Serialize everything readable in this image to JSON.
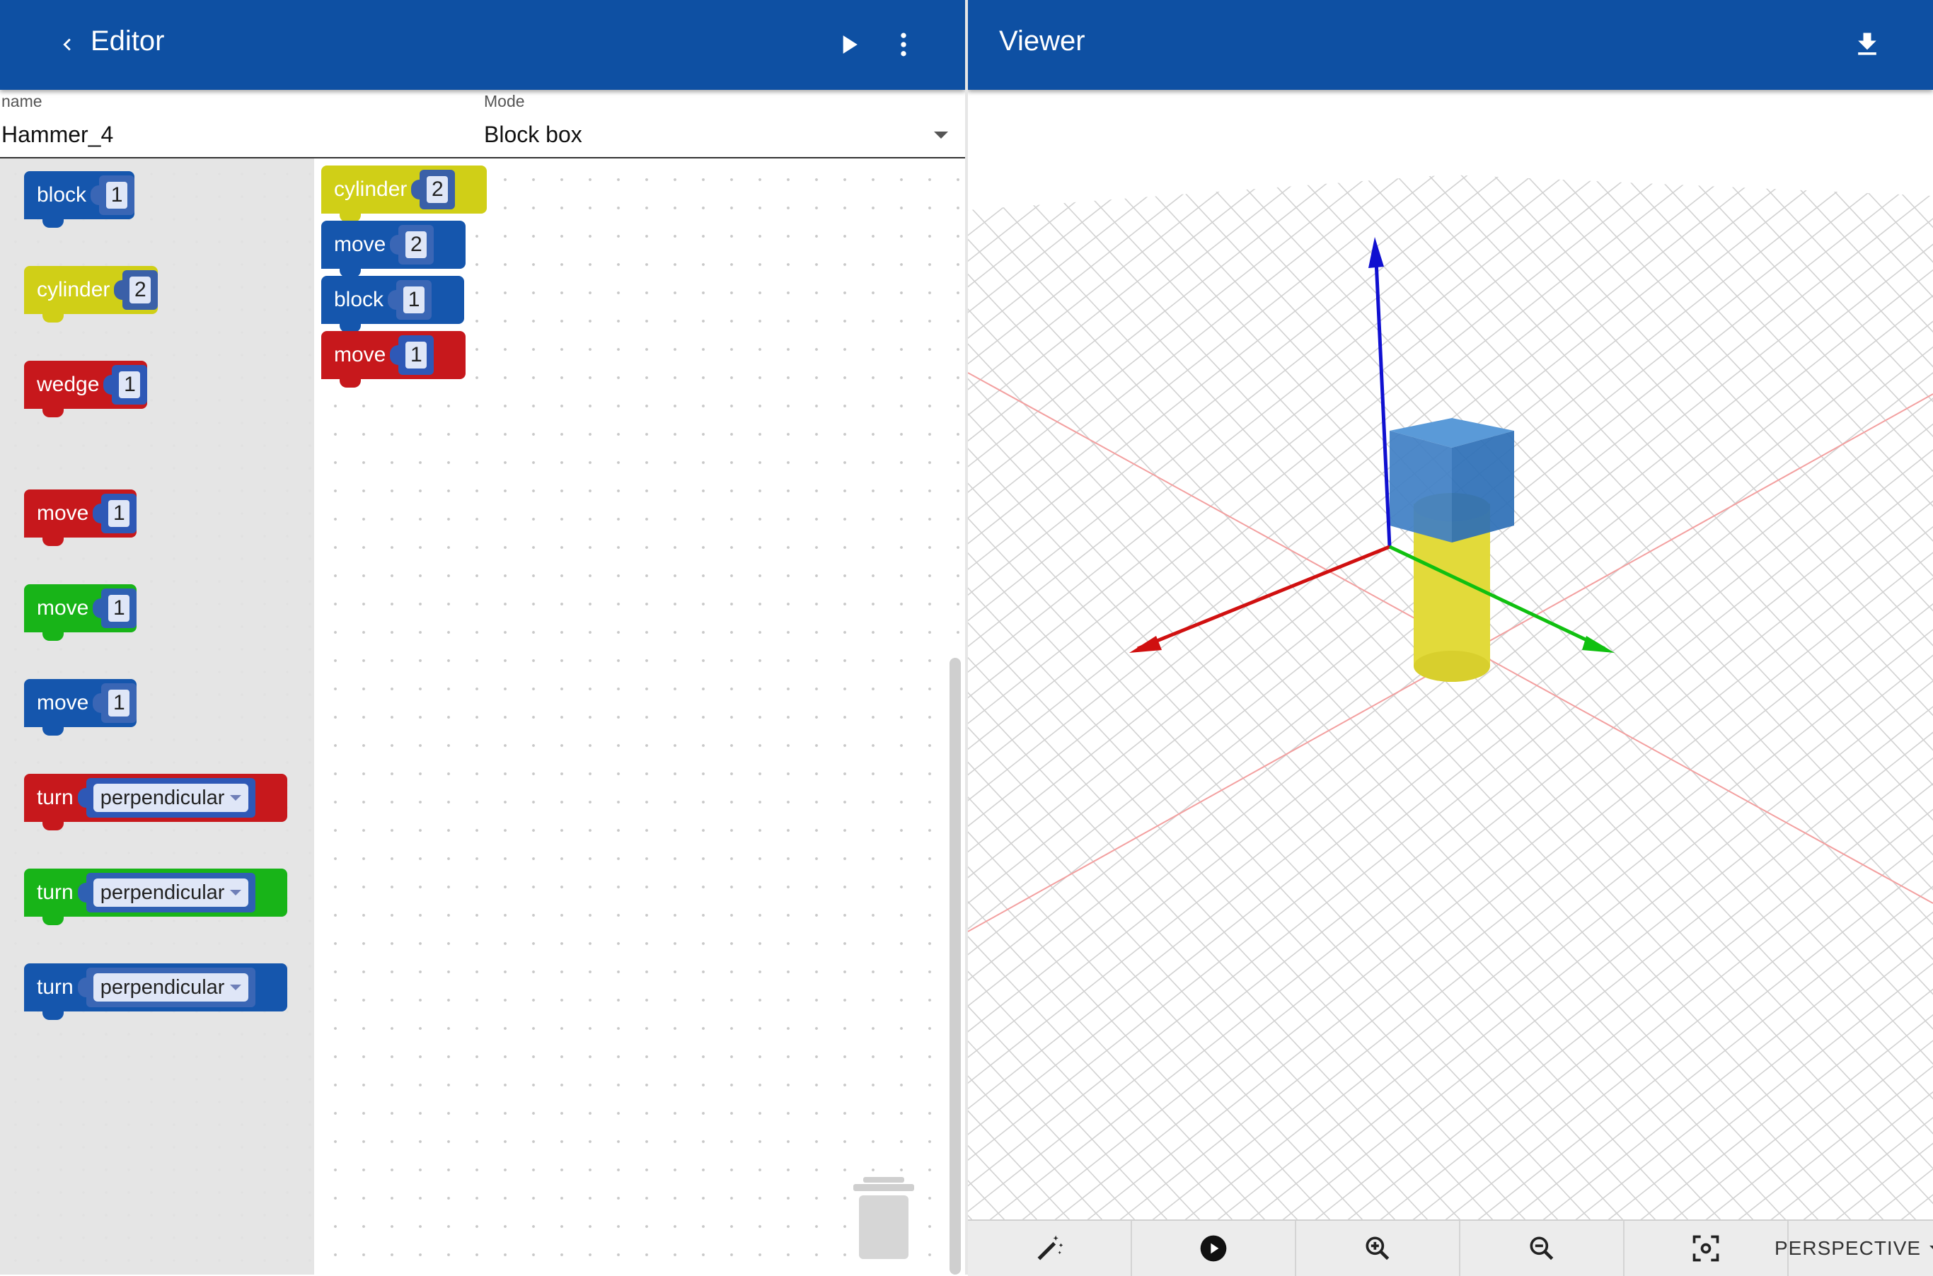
{
  "editor": {
    "title": "Editor",
    "name_label": "name",
    "name_value": "Hammer_4",
    "mode_label": "Mode",
    "mode_value": "Block box"
  },
  "viewer": {
    "title": "Viewer",
    "view_mode": "PERSPECTIVE"
  },
  "toolbox": [
    {
      "label": "block",
      "value": "1",
      "color": "#1556ad"
    },
    {
      "label": "cylinder",
      "value": "2",
      "color": "#d0cf17"
    },
    {
      "label": "wedge",
      "value": "1",
      "color": "#c7181c"
    },
    {
      "label": "move",
      "value": "1",
      "color": "#c7181c"
    },
    {
      "label": "move",
      "value": "1",
      "color": "#18b418"
    },
    {
      "label": "move",
      "value": "1",
      "color": "#1556ad"
    },
    {
      "label": "turn",
      "value": "perpendicular",
      "color": "#c7181c"
    },
    {
      "label": "turn",
      "value": "perpendicular",
      "color": "#18b418"
    },
    {
      "label": "turn",
      "value": "perpendicular",
      "color": "#1556ad"
    }
  ],
  "workspace": [
    {
      "label": "cylinder",
      "value": "2",
      "color": "#d0cf17"
    },
    {
      "label": "move",
      "value": "2",
      "color": "#1556ad"
    },
    {
      "label": "block",
      "value": "1",
      "color": "#1556ad"
    },
    {
      "label": "move",
      "value": "1",
      "color": "#c7181c"
    }
  ],
  "icons": {
    "back": "chevron-left-icon",
    "run": "play-icon",
    "menu": "more-vert-icon",
    "download": "download-icon",
    "trash": "trash-icon",
    "wand": "magic-wand-icon",
    "play": "play-circle-icon",
    "zoom_in": "zoom-in-icon",
    "zoom_out": "zoom-out-icon",
    "center": "center-focus-icon"
  },
  "colors": {
    "appbar": "#0e50a3",
    "x_axis": "#d01010",
    "y_axis": "#10c010",
    "z_axis": "#1010d0"
  }
}
